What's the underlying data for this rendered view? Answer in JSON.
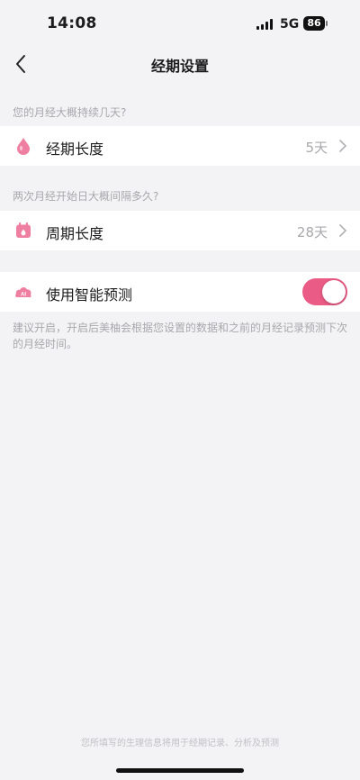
{
  "status_bar": {
    "time": "14:08",
    "network": "5G",
    "battery": "86"
  },
  "nav": {
    "title": "经期设置",
    "back_icon": "chevron-left-icon"
  },
  "period_section": {
    "caption": "您的月经大概持续几天?",
    "label": "经期长度",
    "value": "5天",
    "icon": "drop-icon"
  },
  "cycle_section": {
    "caption": "两次月经开始日大概间隔多久?",
    "label": "周期长度",
    "value": "28天",
    "icon": "calendar-icon"
  },
  "prediction": {
    "label": "使用智能预测",
    "icon_text": "AI",
    "enabled": true,
    "hint": "建议开启，开启后美柚会根据您设置的数据和之前的月经记录预测下次的月经时间。"
  },
  "footer": {
    "note": "您所填写的生理信息将用于经期记录、分析及预测"
  },
  "colors": {
    "accent": "#ea5b85",
    "background": "#f3f3f5"
  }
}
